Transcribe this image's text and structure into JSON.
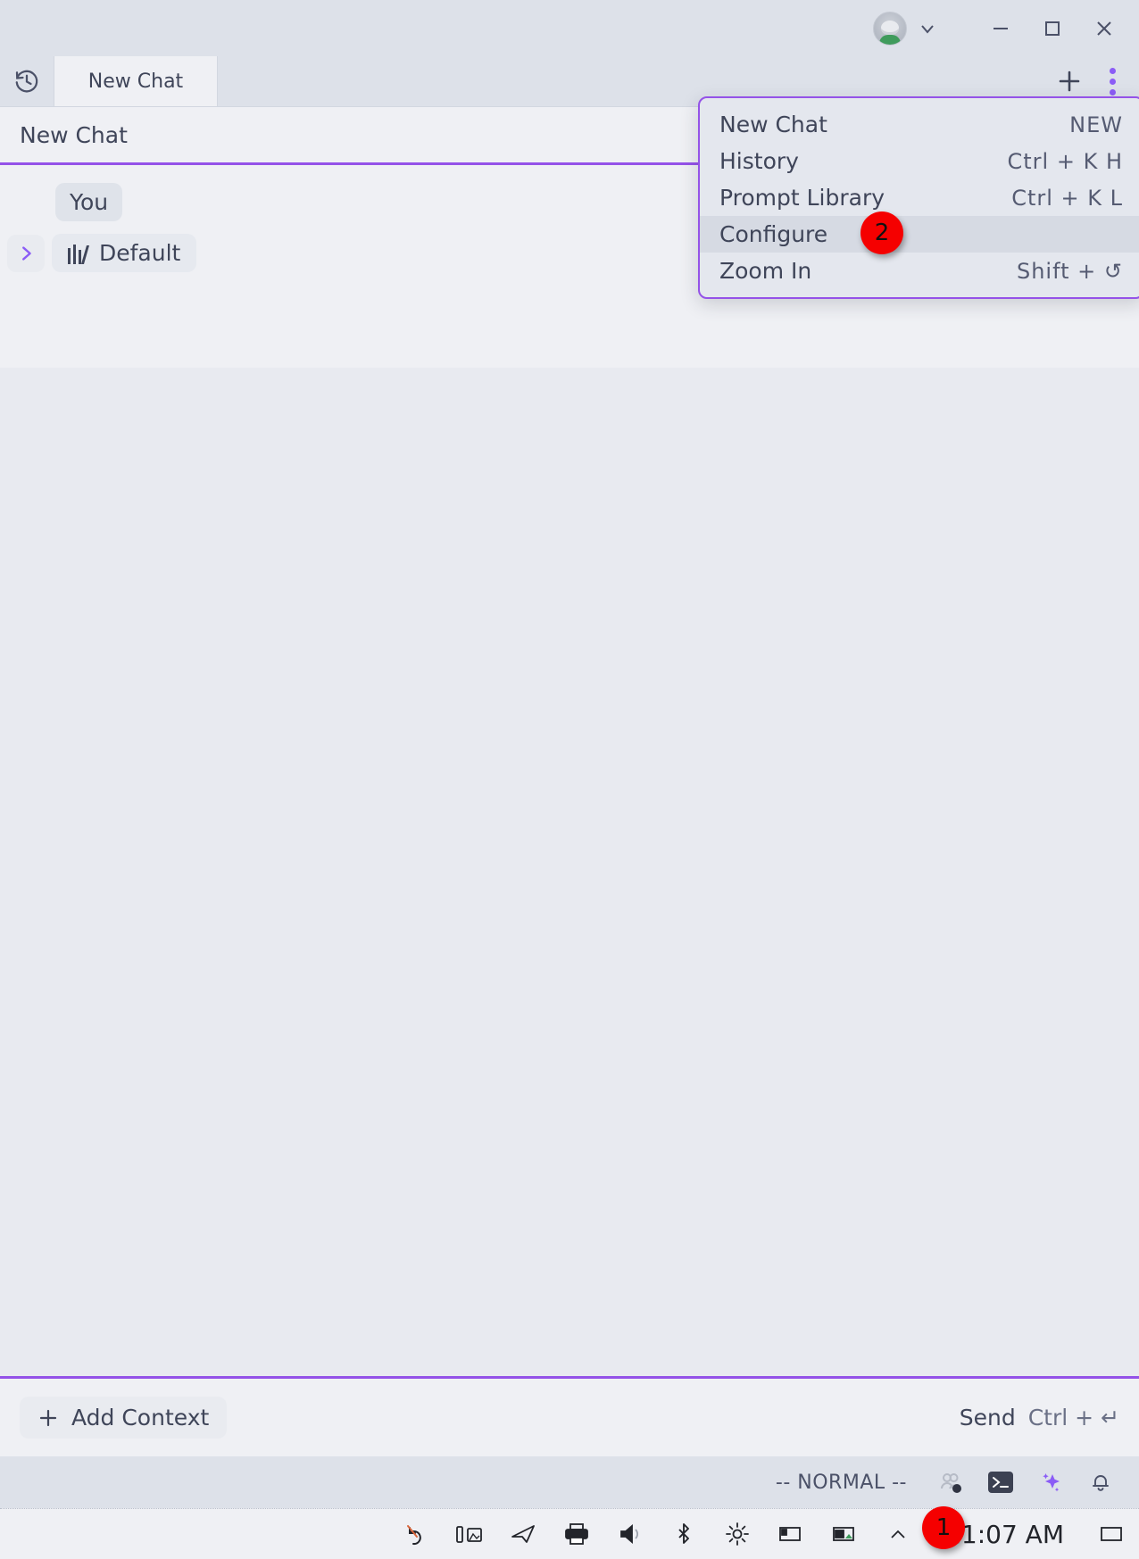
{
  "window": {
    "account_icon": "avatar",
    "account_chevron_icon": "chevron-down-icon",
    "minimize_icon": "minimize-icon",
    "maximize_icon": "maximize-icon",
    "close_icon": "close-icon"
  },
  "tabstrip": {
    "history_icon": "history-clock-icon",
    "tabs": [
      {
        "label": "New Chat"
      }
    ],
    "new_tab_icon": "plus-icon",
    "overflow_icon": "kebab-menu-icon",
    "accent_color": "#8b5cf6"
  },
  "chat": {
    "title": "New Chat",
    "sender_label": "You",
    "expander_icon": "chevron-right-icon",
    "model_icon": "model-bars-icon",
    "model_label": "Default"
  },
  "composer": {
    "add_context_icon": "plus-icon",
    "add_context_label": "Add Context",
    "send_label": "Send",
    "send_shortcut": "Ctrl + ↵"
  },
  "statusbar": {
    "mode": "-- NORMAL --",
    "icons": [
      {
        "name": "collaborators-icon"
      },
      {
        "name": "terminal-icon"
      },
      {
        "name": "sparkle-ai-icon"
      },
      {
        "name": "bell-notification-icon"
      }
    ]
  },
  "menu": {
    "items": [
      {
        "label": "New Chat",
        "shortcut": "NEW",
        "active": false
      },
      {
        "label": "History",
        "shortcut": "Ctrl + K  H",
        "active": false
      },
      {
        "label": "Prompt Library",
        "shortcut": "Ctrl + K  L",
        "active": false
      },
      {
        "label": "Configure",
        "shortcut": "",
        "active": true
      },
      {
        "label": "Zoom In",
        "shortcut": "Shift + ↺",
        "active": false
      }
    ]
  },
  "taskbar": {
    "clock": "11:07 AM",
    "tray_icons": [
      {
        "name": "undo-icon"
      },
      {
        "name": "battery-lab-icon"
      },
      {
        "name": "send-paper-plane-icon"
      },
      {
        "name": "printer-icon"
      },
      {
        "name": "volume-icon"
      },
      {
        "name": "bluetooth-icon"
      },
      {
        "name": "brightness-icon"
      },
      {
        "name": "display-icon"
      },
      {
        "name": "network-icon"
      },
      {
        "name": "chevron-up-icon"
      }
    ],
    "show-desktop_icon": "show-desktop-icon"
  },
  "markers": [
    {
      "id": "1",
      "label": "1"
    },
    {
      "id": "2",
      "label": "2"
    }
  ]
}
